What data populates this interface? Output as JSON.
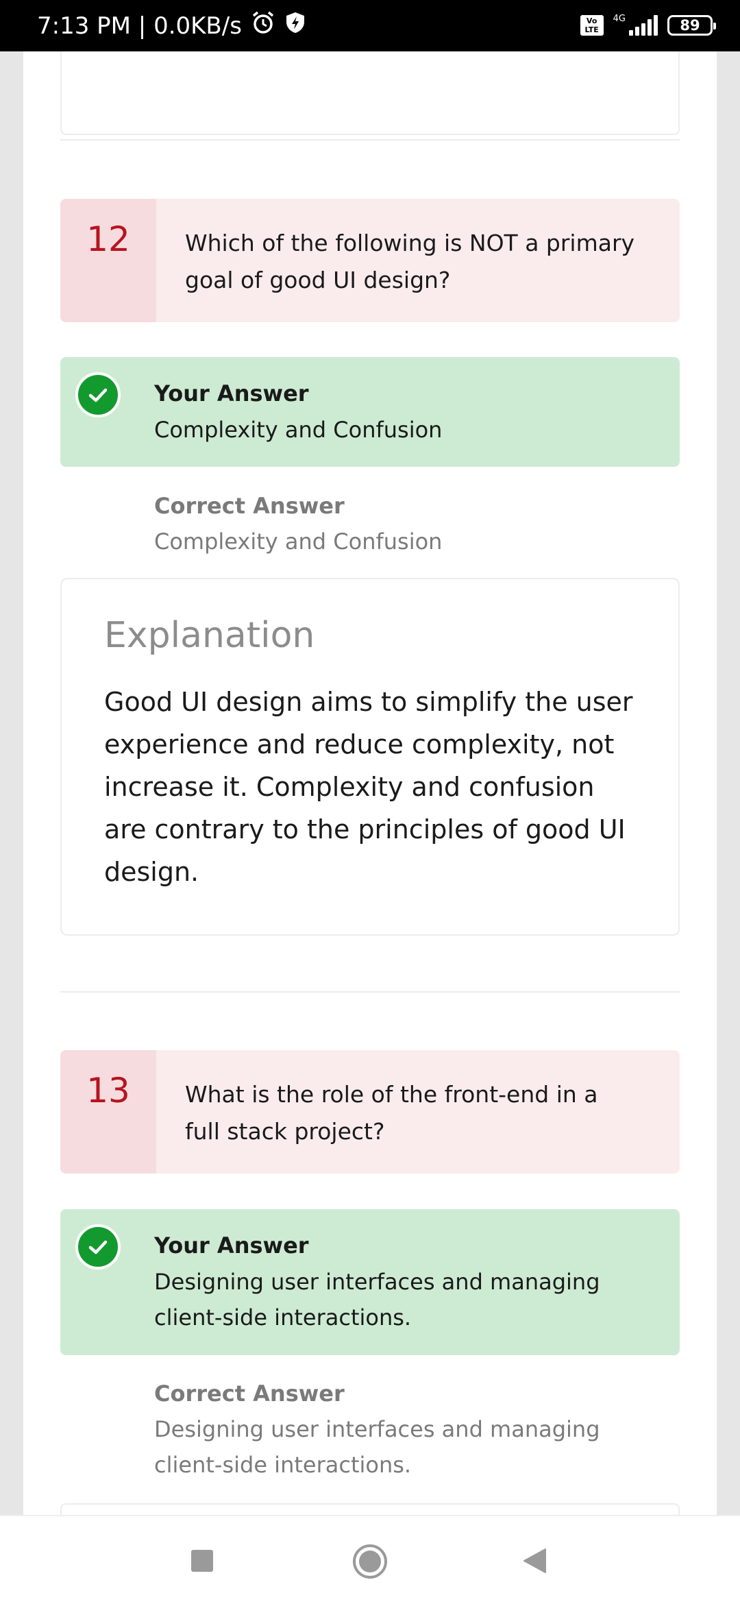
{
  "status_bar": {
    "time_speed": "7:13 PM | 0.0KB/s",
    "network": "4G",
    "volte": "Vo LTE",
    "battery": "89"
  },
  "questions": [
    {
      "number": "12",
      "question": "Which of the following is NOT a primary goal of good UI design?",
      "your_answer_label": "Your Answer",
      "your_answer": "Complexity and Confusion",
      "correct_answer_label": "Correct Answer",
      "correct_answer": "Complexity and Confusion",
      "explanation_title": "Explanation",
      "explanation": "Good UI design aims to simplify the user experience and reduce complexity, not increase it. Complexity and confusion are contrary to the principles of good UI design."
    },
    {
      "number": "13",
      "question": "What is the role of the front-end in a full stack project?",
      "your_answer_label": "Your Answer",
      "your_answer": "Designing user interfaces and managing client-side interactions.",
      "correct_answer_label": "Correct Answer",
      "correct_answer": "Designing user interfaces and managing client-side interactions."
    }
  ],
  "colors": {
    "question_number": "#b7141f",
    "question_bg": "#faecec",
    "answer_bg": "#cdebd3",
    "check": "#139a2e"
  },
  "icons": {
    "alarm": "alarm-icon",
    "shield": "shield-icon",
    "check": "check-icon",
    "nav_recent": "square-icon",
    "nav_home": "circle-icon",
    "nav_back": "triangle-back-icon"
  }
}
